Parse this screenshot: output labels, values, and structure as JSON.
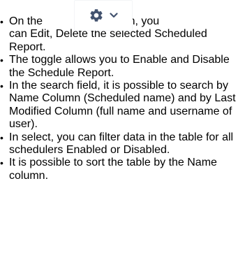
{
  "bullets": [
    {
      "before": "On the",
      "after": "button, you",
      "rest": "can Edit, Delete the selected Scheduled Report."
    },
    {
      "text": "The toggle allows you to Enable and Disable the Schedule Report."
    },
    {
      "text": "In the search field, it is possible to search by Name Column (Scheduled name) and by Last Modified Column (full name and username of user)."
    },
    {
      "text": "In select, you can filter data in the table for all schedulers Enabled or Disabled."
    },
    {
      "text": "It is possible to sort the table by the Name column."
    }
  ],
  "button_icons": [
    "gear-icon",
    "chevron-down-icon"
  ],
  "colors": {
    "icon": "#42526e",
    "text": "#000000"
  }
}
